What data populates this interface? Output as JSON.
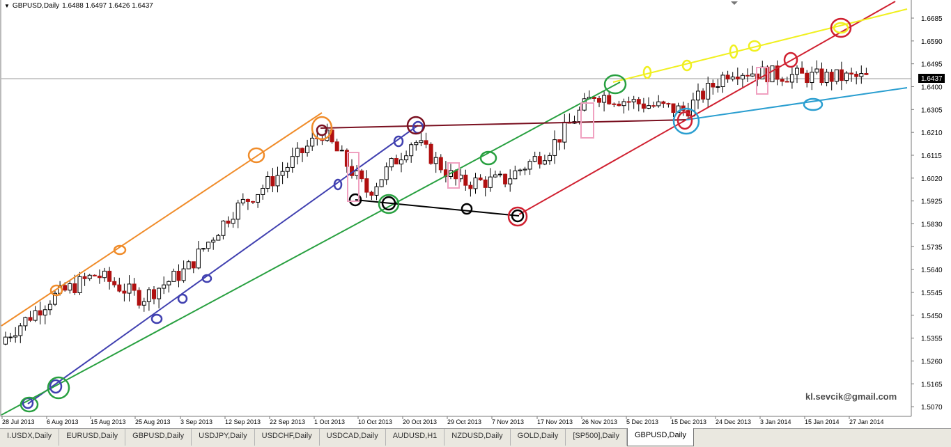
{
  "window": {
    "title": "GBPUSD,Daily",
    "ohlc": "1.6488 1.6497 1.6426 1.6437"
  },
  "price_scale": {
    "labels": [
      "1.6685",
      "1.6590",
      "1.6495",
      "1.6400",
      "1.6305",
      "1.6210",
      "1.6115",
      "1.6020",
      "1.5925",
      "1.5830",
      "1.5735",
      "1.5640",
      "1.5545",
      "1.5450",
      "1.5355",
      "1.5260",
      "1.5165",
      "1.5070"
    ],
    "current_price": "1.6437"
  },
  "time_scale": {
    "labels": [
      "28 Jul 2013",
      "6 Aug 2013",
      "15 Aug 2013",
      "25 Aug 2013",
      "3 Sep 2013",
      "12 Sep 2013",
      "22 Sep 2013",
      "1 Oct 2013",
      "10 Oct 2013",
      "20 Oct 2013",
      "29 Oct 2013",
      "7 Nov 2013",
      "17 Nov 2013",
      "26 Nov 2013",
      "5 Dec 2013",
      "15 Dec 2013",
      "24 Dec 2013",
      "3 Jan 2014",
      "15 Jan 2014",
      "27 Jan 2014"
    ]
  },
  "watermark": "kl.sevcik@gmail.com",
  "tabs": [
    {
      "label": "I.USDX,Daily",
      "active": false
    },
    {
      "label": "EURUSD,Daily",
      "active": false
    },
    {
      "label": "GBPUSD,Daily",
      "active": false
    },
    {
      "label": "USDJPY,Daily",
      "active": false
    },
    {
      "label": "USDCHF,Daily",
      "active": false
    },
    {
      "label": "USDCAD,Daily",
      "active": false
    },
    {
      "label": "AUDUSD,H1",
      "active": false
    },
    {
      "label": "NZDUSD,Daily",
      "active": false
    },
    {
      "label": "GOLD,Daily",
      "active": false
    },
    {
      "label": "[SP500],Daily",
      "active": false
    },
    {
      "label": "GBPUSD,Daily",
      "active": true
    }
  ],
  "colors": {
    "bull": "#000000",
    "bear": "#b01010",
    "orange_line": "#f08c2a",
    "blue_line": "#4040b0",
    "green_line": "#28a040",
    "maroon_line": "#7a1020",
    "red_line": "#d02030",
    "yellow_line": "#f0f020",
    "cyan_line": "#2a9ed0",
    "black_line": "#000000",
    "pink_box": "#f0a0c0"
  },
  "chart_data": {
    "type": "candlestick",
    "symbol": "GBPUSD",
    "timeframe": "Daily",
    "y_range": [
      1.507,
      1.6685
    ],
    "series_close_approx": [
      {
        "date": "28 Jul 2013",
        "close": 1.536
      },
      {
        "date": "6 Aug 2013",
        "close": 1.552
      },
      {
        "date": "15 Aug 2013",
        "close": 1.562
      },
      {
        "date": "25 Aug 2013",
        "close": 1.552
      },
      {
        "date": "3 Sep 2013",
        "close": 1.564
      },
      {
        "date": "12 Sep 2013",
        "close": 1.588
      },
      {
        "date": "22 Sep 2013",
        "close": 1.603
      },
      {
        "date": "1 Oct 2013",
        "close": 1.621
      },
      {
        "date": "10 Oct 2013",
        "close": 1.596
      },
      {
        "date": "20 Oct 2013",
        "close": 1.618
      },
      {
        "date": "29 Oct 2013",
        "close": 1.6
      },
      {
        "date": "7 Nov 2013",
        "close": 1.601
      },
      {
        "date": "17 Nov 2013",
        "close": 1.614
      },
      {
        "date": "26 Nov 2013",
        "close": 1.637
      },
      {
        "date": "5 Dec 2013",
        "close": 1.633
      },
      {
        "date": "15 Dec 2013",
        "close": 1.63
      },
      {
        "date": "24 Dec 2013",
        "close": 1.647
      },
      {
        "date": "3 Jan 2014",
        "close": 1.645
      },
      {
        "date": "15 Jan 2014",
        "close": 1.644
      },
      {
        "date": "27 Jan 2014",
        "close": 1.6437
      }
    ]
  }
}
